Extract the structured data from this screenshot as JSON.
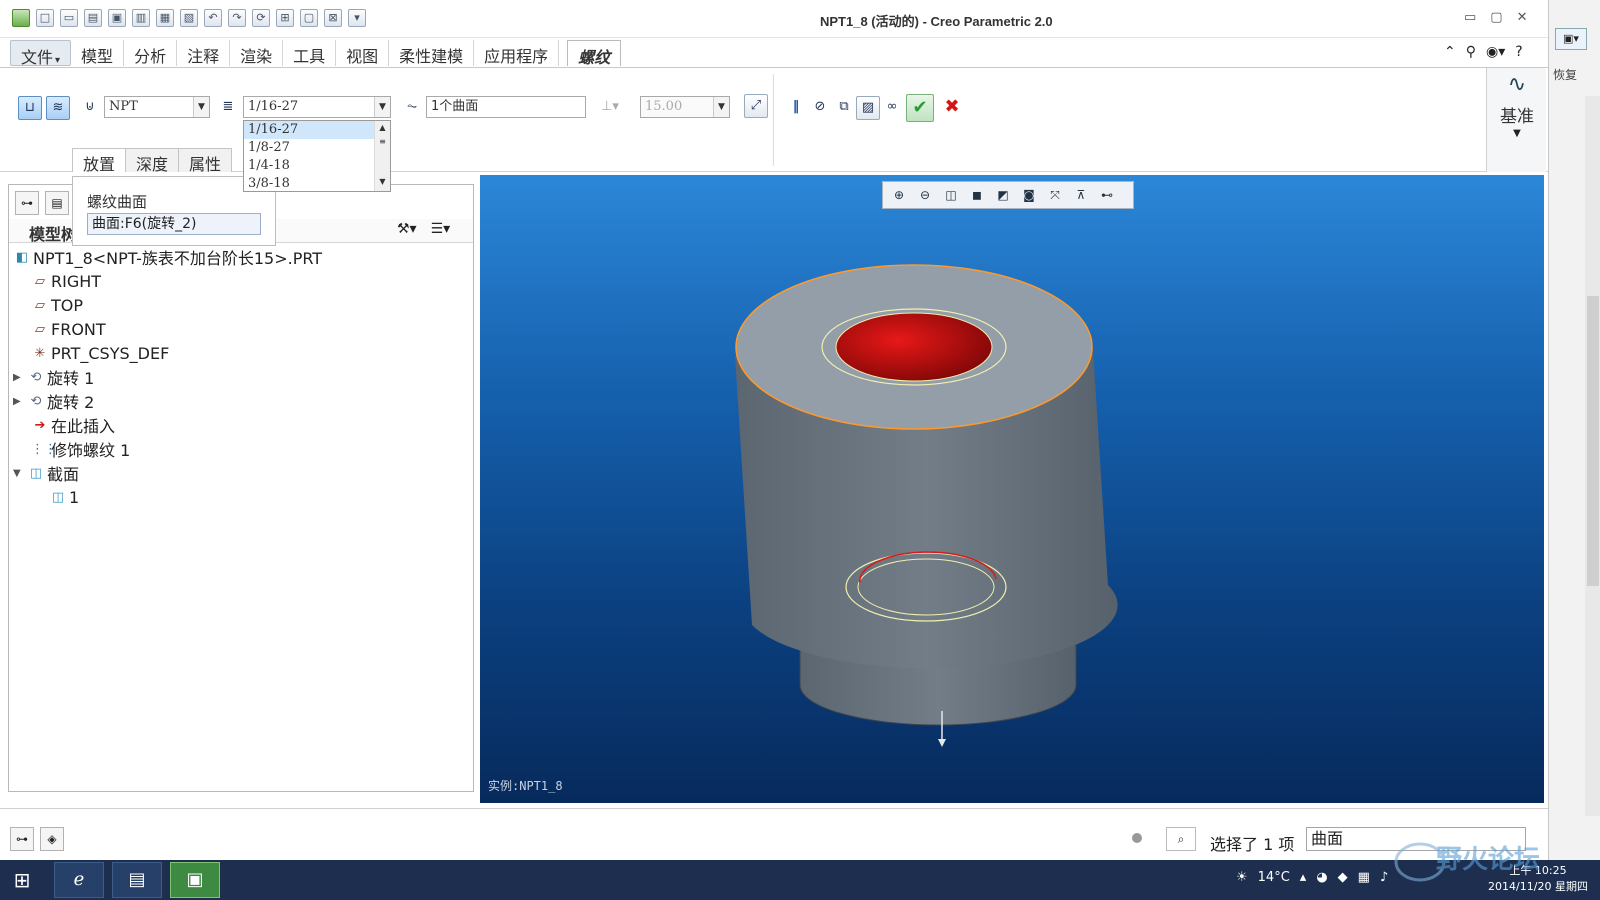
{
  "window": {
    "title": "NPT1_8 (活动的) - Creo Parametric 2.0",
    "controls": [
      "▭",
      "▢",
      "✕"
    ]
  },
  "menu": {
    "tabs": [
      "文件",
      "模型",
      "分析",
      "注释",
      "渲染",
      "工具",
      "视图",
      "柔性建模",
      "应用程序"
    ],
    "active_tab": "螺纹",
    "file_arrow": "▾"
  },
  "ribbon": {
    "thread_type": "NPT",
    "size_value": "1/16-27",
    "surface_value": "1个曲面",
    "depth_value": "15.00",
    "tabs": [
      "放置",
      "深度",
      "属性"
    ],
    "datum_label": "基准",
    "confirm_icon": "check-icon",
    "cancel_icon": "x-icon"
  },
  "size_dropdown": {
    "options": [
      "1/16-27",
      "1/8-27",
      "1/4-18",
      "3/8-18"
    ],
    "selected": "1/16-27"
  },
  "placement_popup": {
    "label": "螺纹曲面",
    "field": "曲面:F6(旋转_2)"
  },
  "model_tree": {
    "header": "模型树",
    "items": [
      {
        "label": "NPT1_8<NPT-族表不加台阶长15>.PRT",
        "icon": "part-icon",
        "exp": ""
      },
      {
        "label": "RIGHT",
        "icon": "datum-plane-icon",
        "exp": ""
      },
      {
        "label": "TOP",
        "icon": "datum-plane-icon",
        "exp": ""
      },
      {
        "label": "FRONT",
        "icon": "datum-plane-icon",
        "exp": ""
      },
      {
        "label": "PRT_CSYS_DEF",
        "icon": "csys-icon",
        "exp": ""
      },
      {
        "label": "旋转 1",
        "icon": "revolve-icon",
        "exp": "▶"
      },
      {
        "label": "旋转 2",
        "icon": "revolve-icon",
        "exp": "▶"
      },
      {
        "label": "在此插入",
        "icon": "insert-arrow-icon",
        "exp": ""
      },
      {
        "label": "修饰螺纹 1",
        "icon": "cosmetic-thread-icon",
        "exp": ""
      },
      {
        "label": "截面",
        "icon": "section-icon",
        "exp": "▼"
      },
      {
        "label": "1",
        "icon": "section-icon",
        "exp": ""
      }
    ]
  },
  "graphics": {
    "view_label": "实例:NPT1_8"
  },
  "status": {
    "selection_text": "选择了 1 项",
    "filter_value": "曲面"
  },
  "taskbar": {
    "temperature": "14°C",
    "time": "上午 10:25",
    "date": "2014/11/20 星期四"
  },
  "right_strip": {
    "text": "恢复"
  },
  "watermark": {
    "text": "野火论坛"
  },
  "colors": {
    "bore_red": "#c01010",
    "body_gray": "#6f7b87",
    "top_face": "#9aa4ae",
    "highlight_orange": "#ff9a2a",
    "thread_yellow": "#f2f0b0",
    "accent_green": "#2c9c3a"
  }
}
